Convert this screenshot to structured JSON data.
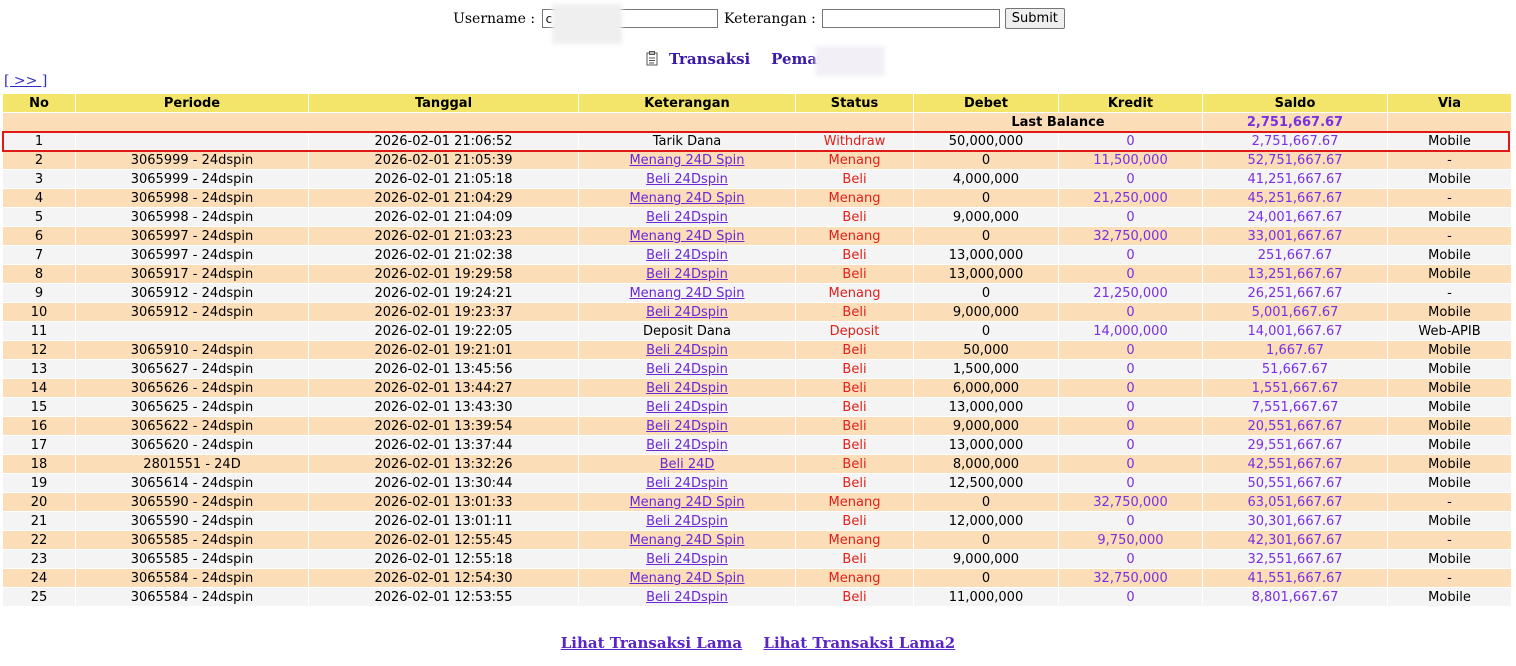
{
  "form": {
    "username_label": "Username :",
    "username_value": "c",
    "keterangan_label": "Keterangan :",
    "keterangan_value": "",
    "submit_label": "Submit"
  },
  "title": {
    "transaksi": "Transaksi",
    "pemain": "Pemain : cli"
  },
  "nav_link": "[ >> ]",
  "columns": [
    "No",
    "Periode",
    "Tanggal",
    "Keterangan",
    "Status",
    "Debet",
    "Kredit",
    "Saldo",
    "Via"
  ],
  "last_balance": {
    "label": "Last Balance",
    "value": "2,751,667.67"
  },
  "rows": [
    {
      "no": "1",
      "periode": "",
      "tanggal": "2026-02-01 21:06:52",
      "keterangan": "Tarik Dana",
      "link": false,
      "status": "Withdraw",
      "debet": "50,000,000",
      "kredit": "0",
      "saldo": "2,751,667.67",
      "via": "Mobile"
    },
    {
      "no": "2",
      "periode": "3065999 - 24dspin",
      "tanggal": "2026-02-01 21:05:39",
      "keterangan": "Menang 24D Spin",
      "link": true,
      "status": "Menang",
      "debet": "0",
      "kredit": "11,500,000",
      "saldo": "52,751,667.67",
      "via": "-"
    },
    {
      "no": "3",
      "periode": "3065999 - 24dspin",
      "tanggal": "2026-02-01 21:05:18",
      "keterangan": "Beli 24Dspin",
      "link": true,
      "status": "Beli",
      "debet": "4,000,000",
      "kredit": "0",
      "saldo": "41,251,667.67",
      "via": "Mobile"
    },
    {
      "no": "4",
      "periode": "3065998 - 24dspin",
      "tanggal": "2026-02-01 21:04:29",
      "keterangan": "Menang 24D Spin",
      "link": true,
      "status": "Menang",
      "debet": "0",
      "kredit": "21,250,000",
      "saldo": "45,251,667.67",
      "via": "-"
    },
    {
      "no": "5",
      "periode": "3065998 - 24dspin",
      "tanggal": "2026-02-01 21:04:09",
      "keterangan": "Beli 24Dspin",
      "link": true,
      "status": "Beli",
      "debet": "9,000,000",
      "kredit": "0",
      "saldo": "24,001,667.67",
      "via": "Mobile"
    },
    {
      "no": "6",
      "periode": "3065997 - 24dspin",
      "tanggal": "2026-02-01 21:03:23",
      "keterangan": "Menang 24D Spin",
      "link": true,
      "status": "Menang",
      "debet": "0",
      "kredit": "32,750,000",
      "saldo": "33,001,667.67",
      "via": "-"
    },
    {
      "no": "7",
      "periode": "3065997 - 24dspin",
      "tanggal": "2026-02-01 21:02:38",
      "keterangan": "Beli 24Dspin",
      "link": true,
      "status": "Beli",
      "debet": "13,000,000",
      "kredit": "0",
      "saldo": "251,667.67",
      "via": "Mobile"
    },
    {
      "no": "8",
      "periode": "3065917 - 24dspin",
      "tanggal": "2026-02-01 19:29:58",
      "keterangan": "Beli 24Dspin",
      "link": true,
      "status": "Beli",
      "debet": "13,000,000",
      "kredit": "0",
      "saldo": "13,251,667.67",
      "via": "Mobile"
    },
    {
      "no": "9",
      "periode": "3065912 - 24dspin",
      "tanggal": "2026-02-01 19:24:21",
      "keterangan": "Menang 24D Spin",
      "link": true,
      "status": "Menang",
      "debet": "0",
      "kredit": "21,250,000",
      "saldo": "26,251,667.67",
      "via": "-"
    },
    {
      "no": "10",
      "periode": "3065912 - 24dspin",
      "tanggal": "2026-02-01 19:23:37",
      "keterangan": "Beli 24Dspin",
      "link": true,
      "status": "Beli",
      "debet": "9,000,000",
      "kredit": "0",
      "saldo": "5,001,667.67",
      "via": "Mobile"
    },
    {
      "no": "11",
      "periode": "",
      "tanggal": "2026-02-01 19:22:05",
      "keterangan": "Deposit Dana",
      "link": false,
      "status": "Deposit",
      "debet": "0",
      "kredit": "14,000,000",
      "saldo": "14,001,667.67",
      "via": "Web-APIB"
    },
    {
      "no": "12",
      "periode": "3065910 - 24dspin",
      "tanggal": "2026-02-01 19:21:01",
      "keterangan": "Beli 24Dspin",
      "link": true,
      "status": "Beli",
      "debet": "50,000",
      "kredit": "0",
      "saldo": "1,667.67",
      "via": "Mobile"
    },
    {
      "no": "13",
      "periode": "3065627 - 24dspin",
      "tanggal": "2026-02-01 13:45:56",
      "keterangan": "Beli 24Dspin",
      "link": true,
      "status": "Beli",
      "debet": "1,500,000",
      "kredit": "0",
      "saldo": "51,667.67",
      "via": "Mobile"
    },
    {
      "no": "14",
      "periode": "3065626 - 24dspin",
      "tanggal": "2026-02-01 13:44:27",
      "keterangan": "Beli 24Dspin",
      "link": true,
      "status": "Beli",
      "debet": "6,000,000",
      "kredit": "0",
      "saldo": "1,551,667.67",
      "via": "Mobile"
    },
    {
      "no": "15",
      "periode": "3065625 - 24dspin",
      "tanggal": "2026-02-01 13:43:30",
      "keterangan": "Beli 24Dspin",
      "link": true,
      "status": "Beli",
      "debet": "13,000,000",
      "kredit": "0",
      "saldo": "7,551,667.67",
      "via": "Mobile"
    },
    {
      "no": "16",
      "periode": "3065622 - 24dspin",
      "tanggal": "2026-02-01 13:39:54",
      "keterangan": "Beli 24Dspin",
      "link": true,
      "status": "Beli",
      "debet": "9,000,000",
      "kredit": "0",
      "saldo": "20,551,667.67",
      "via": "Mobile"
    },
    {
      "no": "17",
      "periode": "3065620 - 24dspin",
      "tanggal": "2026-02-01 13:37:44",
      "keterangan": "Beli 24Dspin",
      "link": true,
      "status": "Beli",
      "debet": "13,000,000",
      "kredit": "0",
      "saldo": "29,551,667.67",
      "via": "Mobile"
    },
    {
      "no": "18",
      "periode": "2801551 - 24D",
      "tanggal": "2026-02-01 13:32:26",
      "keterangan": "Beli 24D",
      "link": true,
      "status": "Beli",
      "debet": "8,000,000",
      "kredit": "0",
      "saldo": "42,551,667.67",
      "via": "Mobile"
    },
    {
      "no": "19",
      "periode": "3065614 - 24dspin",
      "tanggal": "2026-02-01 13:30:44",
      "keterangan": "Beli 24Dspin",
      "link": true,
      "status": "Beli",
      "debet": "12,500,000",
      "kredit": "0",
      "saldo": "50,551,667.67",
      "via": "Mobile"
    },
    {
      "no": "20",
      "periode": "3065590 - 24dspin",
      "tanggal": "2026-02-01 13:01:33",
      "keterangan": "Menang 24D Spin",
      "link": true,
      "status": "Menang",
      "debet": "0",
      "kredit": "32,750,000",
      "saldo": "63,051,667.67",
      "via": "-"
    },
    {
      "no": "21",
      "periode": "3065590 - 24dspin",
      "tanggal": "2026-02-01 13:01:11",
      "keterangan": "Beli 24Dspin",
      "link": true,
      "status": "Beli",
      "debet": "12,000,000",
      "kredit": "0",
      "saldo": "30,301,667.67",
      "via": "Mobile"
    },
    {
      "no": "22",
      "periode": "3065585 - 24dspin",
      "tanggal": "2026-02-01 12:55:45",
      "keterangan": "Menang 24D Spin",
      "link": true,
      "status": "Menang",
      "debet": "0",
      "kredit": "9,750,000",
      "saldo": "42,301,667.67",
      "via": "-"
    },
    {
      "no": "23",
      "periode": "3065585 - 24dspin",
      "tanggal": "2026-02-01 12:55:18",
      "keterangan": "Beli 24Dspin",
      "link": true,
      "status": "Beli",
      "debet": "9,000,000",
      "kredit": "0",
      "saldo": "32,551,667.67",
      "via": "Mobile"
    },
    {
      "no": "24",
      "periode": "3065584 - 24dspin",
      "tanggal": "2026-02-01 12:54:30",
      "keterangan": "Menang 24D Spin",
      "link": true,
      "status": "Menang",
      "debet": "0",
      "kredit": "32,750,000",
      "saldo": "41,551,667.67",
      "via": "-"
    },
    {
      "no": "25",
      "periode": "3065584 - 24dspin",
      "tanggal": "2026-02-01 12:53:55",
      "keterangan": "Beli 24Dspin",
      "link": true,
      "status": "Beli",
      "debet": "11,000,000",
      "kredit": "0",
      "saldo": "8,801,667.67",
      "via": "Mobile"
    }
  ],
  "footer": {
    "link1": "Lihat Transaksi Lama",
    "link2": "Lihat Transaksi Lama2"
  },
  "colors": {
    "header_bg": "#f2e56a",
    "row_even_bg": "#fbddb8",
    "row_odd_bg": "#f4f4f4",
    "purple_value": "#7a2fe0",
    "status_red": "#e0201c",
    "highlight_border": "#e01818"
  },
  "icons": {
    "title_icon": "document-icon"
  }
}
